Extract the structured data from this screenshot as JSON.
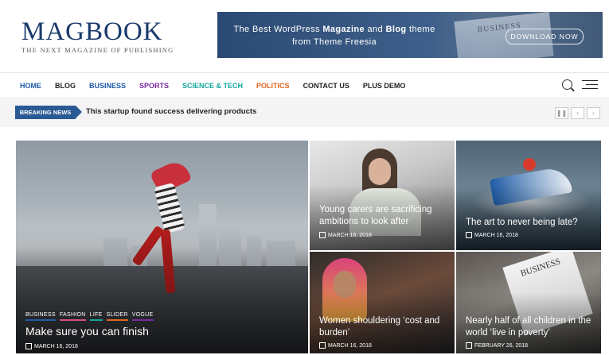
{
  "header": {
    "logo_title": "MAGBOOK",
    "logo_tagline": "THE NEXT MAGAZINE OF PUBLISHING",
    "banner": {
      "text_pre": "The Best WordPress ",
      "text_b1": "Magazine",
      "text_mid": " and ",
      "text_b2": "Blog",
      "text_post": " theme",
      "text_line2": "from Theme Freesia",
      "paper_word": "BUSINESS",
      "cta": "DOWNLOAD NOW"
    }
  },
  "nav": {
    "items": [
      {
        "label": "HOME",
        "color": "#1f5aa6"
      },
      {
        "label": "BLOG",
        "color": "#222222"
      },
      {
        "label": "BUSINESS",
        "color": "#1f5aa6"
      },
      {
        "label": "SPORTS",
        "color": "#7b2aa5"
      },
      {
        "label": "SCIENCE & TECH",
        "color": "#14a6a0"
      },
      {
        "label": "POLITICS",
        "color": "#e3651c"
      },
      {
        "label": "CONTACT US",
        "color": "#222222"
      },
      {
        "label": "PLUS DEMO",
        "color": "#222222"
      }
    ]
  },
  "breaking": {
    "label": "BREAKING NEWS",
    "text": "This startup found success delivering products"
  },
  "featured": {
    "main": {
      "tags": [
        "BUSINESS",
        "FASHION",
        "LIFE",
        "SLIDER",
        "VOGUE"
      ],
      "title": "Make sure you can finish",
      "date": "MARCH 16, 2018"
    },
    "cards": [
      {
        "title": "Young carers are sacrificing ambitions to look after",
        "date": "MARCH 16, 2018"
      },
      {
        "title": "The art to never being late?",
        "date": "MARCH 16, 2018"
      },
      {
        "title": "Women shouldering ‘cost and burden’",
        "date": "MARCH 16, 2018"
      },
      {
        "title": "Nearly half of all children in the world ‘live in poverty’",
        "date": "FEBRUARY 26, 2018",
        "paper_word": "BUSINESS"
      }
    ]
  },
  "colors": {
    "brand": "#1a3a6b",
    "breaking": "#2a5a94"
  }
}
